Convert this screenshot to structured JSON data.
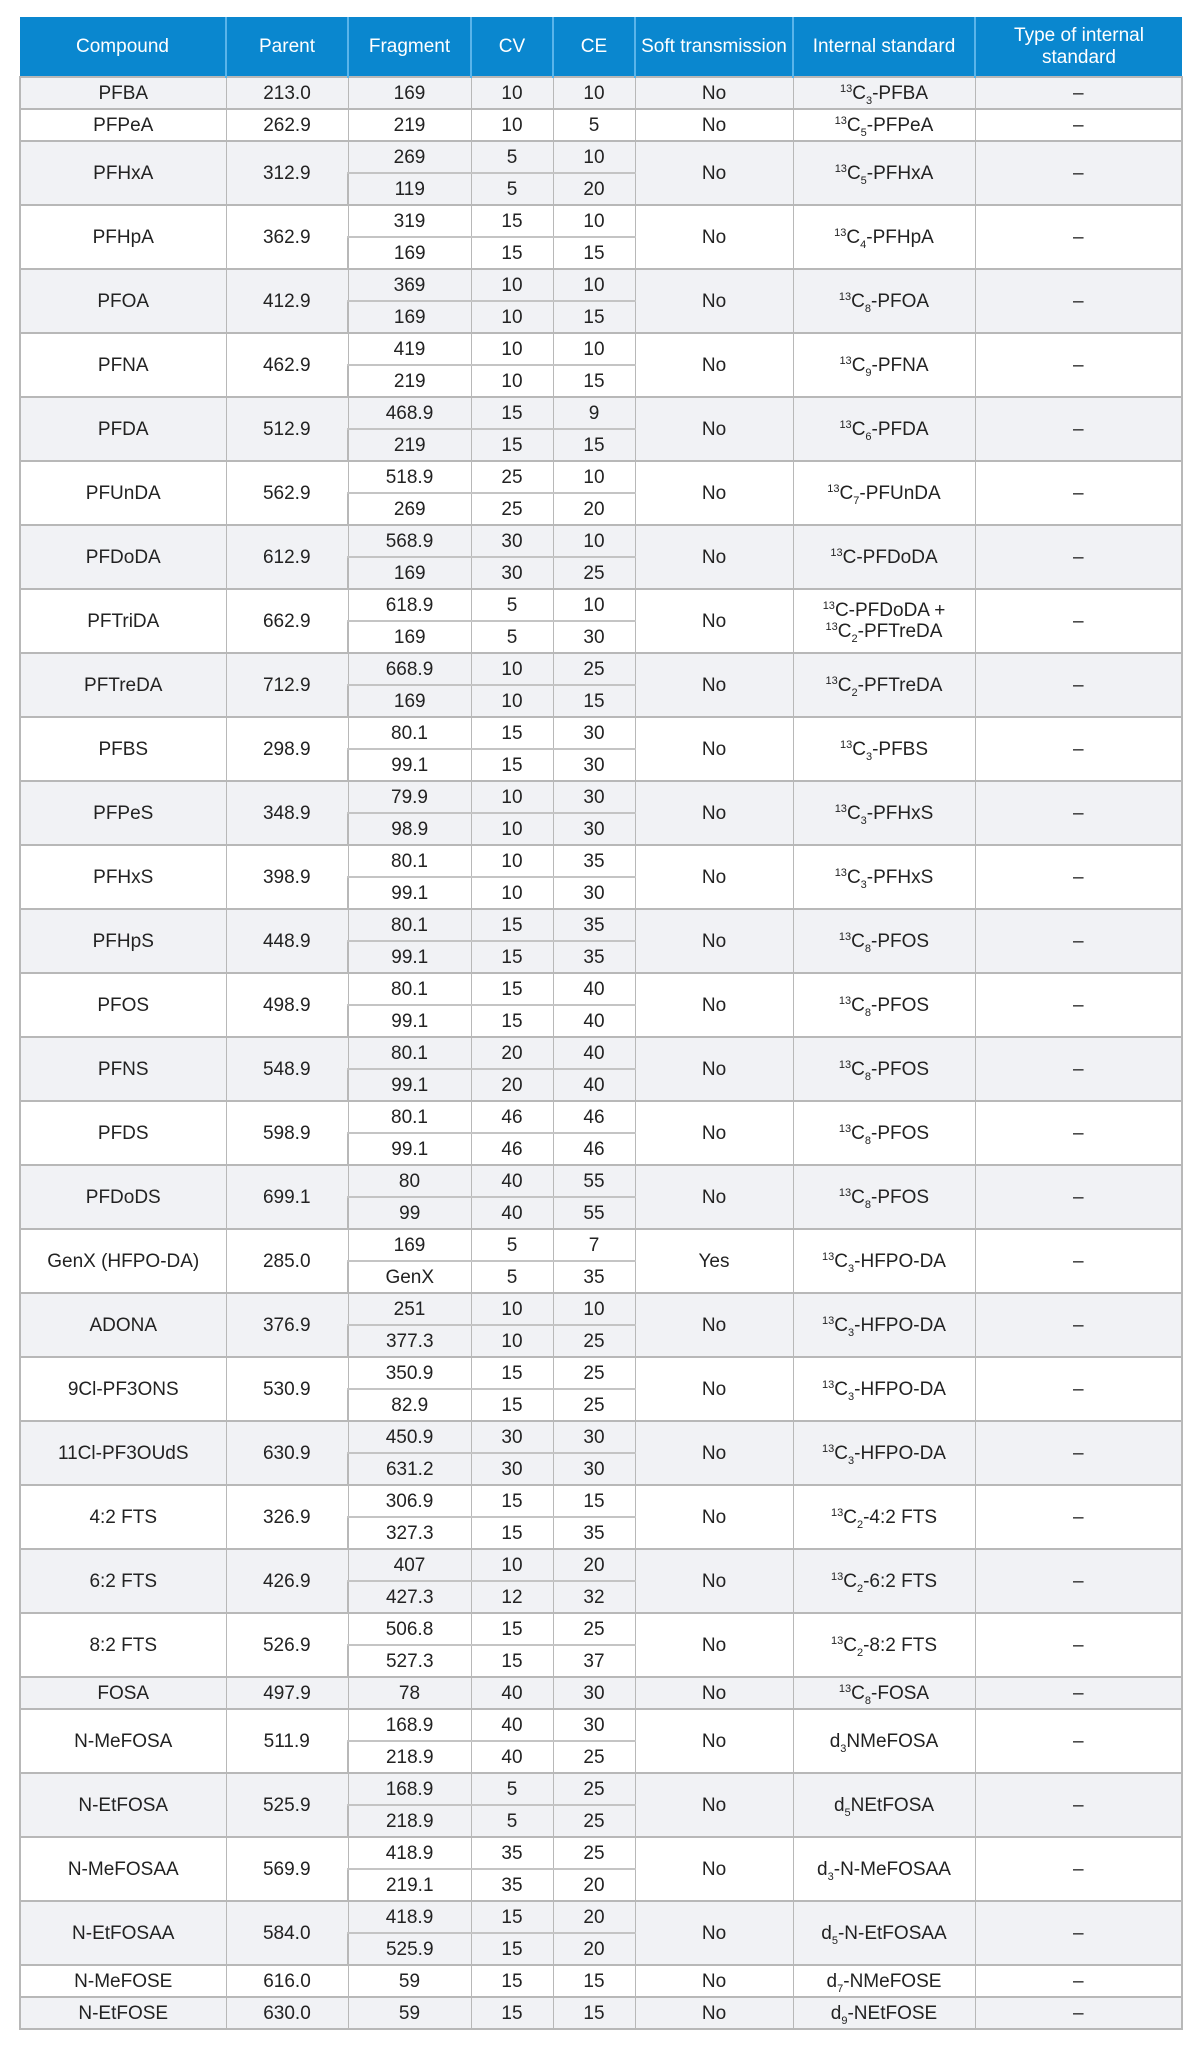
{
  "table": {
    "headers": {
      "compound": "Compound",
      "parent": "Parent",
      "fragment": "Fragment",
      "cv": "CV",
      "ce": "CE",
      "soft_transmission": "Soft transmission",
      "internal_standard": "Internal standard",
      "type_of_internal_standard": "Type of internal standard"
    },
    "colors": {
      "header_bg": "#0a87cf",
      "header_text": "#ffffff",
      "alt_row_bg": "#f1f2f5",
      "border": "#b8b8b8"
    },
    "rows": [
      {
        "compound": "PFBA",
        "parent": "213.0",
        "transitions": [
          {
            "fragment": "169",
            "cv": "10",
            "ce": "10"
          }
        ],
        "soft": "No",
        "is": [
          {
            "sup": "13",
            "base": "C",
            "sub": "3",
            "rest": "-PFBA"
          }
        ],
        "type": "–"
      },
      {
        "compound": "PFPeA",
        "parent": "262.9",
        "transitions": [
          {
            "fragment": "219",
            "cv": "10",
            "ce": "5"
          }
        ],
        "soft": "No",
        "is": [
          {
            "sup": "13",
            "base": "C",
            "sub": "5",
            "rest": "-PFPeA"
          }
        ],
        "type": "–"
      },
      {
        "compound": "PFHxA",
        "parent": "312.9",
        "transitions": [
          {
            "fragment": "269",
            "cv": "5",
            "ce": "10"
          },
          {
            "fragment": "119",
            "cv": "5",
            "ce": "20"
          }
        ],
        "soft": "No",
        "is": [
          {
            "sup": "13",
            "base": "C",
            "sub": "5",
            "rest": "-PFHxA"
          }
        ],
        "type": "–"
      },
      {
        "compound": "PFHpA",
        "parent": "362.9",
        "transitions": [
          {
            "fragment": "319",
            "cv": "15",
            "ce": "10"
          },
          {
            "fragment": "169",
            "cv": "15",
            "ce": "15"
          }
        ],
        "soft": "No",
        "is": [
          {
            "sup": "13",
            "base": "C",
            "sub": "4",
            "rest": "-PFHpA"
          }
        ],
        "type": "–"
      },
      {
        "compound": "PFOA",
        "parent": "412.9",
        "transitions": [
          {
            "fragment": "369",
            "cv": "10",
            "ce": "10"
          },
          {
            "fragment": "169",
            "cv": "10",
            "ce": "15"
          }
        ],
        "soft": "No",
        "is": [
          {
            "sup": "13",
            "base": "C",
            "sub": "8",
            "rest": "-PFOA"
          }
        ],
        "type": "–"
      },
      {
        "compound": "PFNA",
        "parent": "462.9",
        "transitions": [
          {
            "fragment": "419",
            "cv": "10",
            "ce": "10"
          },
          {
            "fragment": "219",
            "cv": "10",
            "ce": "15"
          }
        ],
        "soft": "No",
        "is": [
          {
            "sup": "13",
            "base": "C",
            "sub": "9",
            "rest": "-PFNA"
          }
        ],
        "type": "–"
      },
      {
        "compound": "PFDA",
        "parent": "512.9",
        "transitions": [
          {
            "fragment": "468.9",
            "cv": "15",
            "ce": "9"
          },
          {
            "fragment": "219",
            "cv": "15",
            "ce": "15"
          }
        ],
        "soft": "No",
        "is": [
          {
            "sup": "13",
            "base": "C",
            "sub": "6",
            "rest": "-PFDA"
          }
        ],
        "type": "–"
      },
      {
        "compound": "PFUnDA",
        "parent": "562.9",
        "transitions": [
          {
            "fragment": "518.9",
            "cv": "25",
            "ce": "10"
          },
          {
            "fragment": "269",
            "cv": "25",
            "ce": "20"
          }
        ],
        "soft": "No",
        "is": [
          {
            "sup": "13",
            "base": "C",
            "sub": "7",
            "rest": "-PFUnDA"
          }
        ],
        "type": "–"
      },
      {
        "compound": "PFDoDA",
        "parent": "612.9",
        "transitions": [
          {
            "fragment": "568.9",
            "cv": "30",
            "ce": "10"
          },
          {
            "fragment": "169",
            "cv": "30",
            "ce": "25"
          }
        ],
        "soft": "No",
        "is": [
          {
            "sup": "13",
            "base": "C",
            "sub": "",
            "rest": "-PFDoDA"
          }
        ],
        "type": "–"
      },
      {
        "compound": "PFTriDA",
        "parent": "662.9",
        "transitions": [
          {
            "fragment": "618.9",
            "cv": "5",
            "ce": "10"
          },
          {
            "fragment": "169",
            "cv": "5",
            "ce": "30"
          }
        ],
        "soft": "No",
        "is": [
          {
            "sup": "13",
            "base": "C",
            "sub": "",
            "rest": "-PFDoDA +"
          },
          {
            "sup": "13",
            "base": "C",
            "sub": "2",
            "rest": "-PFTreDA"
          }
        ],
        "type": "–"
      },
      {
        "compound": "PFTreDA",
        "parent": "712.9",
        "transitions": [
          {
            "fragment": "668.9",
            "cv": "10",
            "ce": "25"
          },
          {
            "fragment": "169",
            "cv": "10",
            "ce": "15"
          }
        ],
        "soft": "No",
        "is": [
          {
            "sup": "13",
            "base": "C",
            "sub": "2",
            "rest": "-PFTreDA"
          }
        ],
        "type": "–"
      },
      {
        "compound": "PFBS",
        "parent": "298.9",
        "transitions": [
          {
            "fragment": "80.1",
            "cv": "15",
            "ce": "30"
          },
          {
            "fragment": "99.1",
            "cv": "15",
            "ce": "30"
          }
        ],
        "soft": "No",
        "is": [
          {
            "sup": "13",
            "base": "C",
            "sub": "3",
            "rest": "-PFBS"
          }
        ],
        "type": "–"
      },
      {
        "compound": "PFPeS",
        "parent": "348.9",
        "transitions": [
          {
            "fragment": "79.9",
            "cv": "10",
            "ce": "30"
          },
          {
            "fragment": "98.9",
            "cv": "10",
            "ce": "30"
          }
        ],
        "soft": "No",
        "is": [
          {
            "sup": "13",
            "base": "C",
            "sub": "3",
            "rest": "-PFHxS"
          }
        ],
        "type": "–"
      },
      {
        "compound": "PFHxS",
        "parent": "398.9",
        "transitions": [
          {
            "fragment": "80.1",
            "cv": "10",
            "ce": "35"
          },
          {
            "fragment": "99.1",
            "cv": "10",
            "ce": "30"
          }
        ],
        "soft": "No",
        "is": [
          {
            "sup": "13",
            "base": "C",
            "sub": "3",
            "rest": "-PFHxS"
          }
        ],
        "type": "–"
      },
      {
        "compound": "PFHpS",
        "parent": "448.9",
        "transitions": [
          {
            "fragment": "80.1",
            "cv": "15",
            "ce": "35"
          },
          {
            "fragment": "99.1",
            "cv": "15",
            "ce": "35"
          }
        ],
        "soft": "No",
        "is": [
          {
            "sup": "13",
            "base": "C",
            "sub": "8",
            "rest": "-PFOS"
          }
        ],
        "type": "–"
      },
      {
        "compound": "PFOS",
        "parent": "498.9",
        "transitions": [
          {
            "fragment": "80.1",
            "cv": "15",
            "ce": "40"
          },
          {
            "fragment": "99.1",
            "cv": "15",
            "ce": "40"
          }
        ],
        "soft": "No",
        "is": [
          {
            "sup": "13",
            "base": "C",
            "sub": "8",
            "rest": "-PFOS"
          }
        ],
        "type": "–"
      },
      {
        "compound": "PFNS",
        "parent": "548.9",
        "transitions": [
          {
            "fragment": "80.1",
            "cv": "20",
            "ce": "40"
          },
          {
            "fragment": "99.1",
            "cv": "20",
            "ce": "40"
          }
        ],
        "soft": "No",
        "is": [
          {
            "sup": "13",
            "base": "C",
            "sub": "8",
            "rest": "-PFOS"
          }
        ],
        "type": "–"
      },
      {
        "compound": "PFDS",
        "parent": "598.9",
        "transitions": [
          {
            "fragment": "80.1",
            "cv": "46",
            "ce": "46"
          },
          {
            "fragment": "99.1",
            "cv": "46",
            "ce": "46"
          }
        ],
        "soft": "No",
        "is": [
          {
            "sup": "13",
            "base": "C",
            "sub": "8",
            "rest": "-PFOS"
          }
        ],
        "type": "–"
      },
      {
        "compound": "PFDoDS",
        "parent": "699.1",
        "transitions": [
          {
            "fragment": "80",
            "cv": "40",
            "ce": "55"
          },
          {
            "fragment": "99",
            "cv": "40",
            "ce": "55"
          }
        ],
        "soft": "No",
        "is": [
          {
            "sup": "13",
            "base": "C",
            "sub": "8",
            "rest": "-PFOS"
          }
        ],
        "type": "–"
      },
      {
        "compound": "GenX (HFPO-DA)",
        "parent": "285.0",
        "transitions": [
          {
            "fragment": "169",
            "cv": "5",
            "ce": "7"
          },
          {
            "fragment": "GenX",
            "cv": "5",
            "ce": "35"
          }
        ],
        "soft": "Yes",
        "is": [
          {
            "sup": "13",
            "base": "C",
            "sub": "3",
            "rest": "-HFPO-DA"
          }
        ],
        "type": "–"
      },
      {
        "compound": "ADONA",
        "parent": "376.9",
        "transitions": [
          {
            "fragment": "251",
            "cv": "10",
            "ce": "10"
          },
          {
            "fragment": "377.3",
            "cv": "10",
            "ce": "25"
          }
        ],
        "soft": "No",
        "is": [
          {
            "sup": "13",
            "base": "C",
            "sub": "3",
            "rest": "-HFPO-DA"
          }
        ],
        "type": "–"
      },
      {
        "compound": "9Cl-PF3ONS",
        "parent": "530.9",
        "transitions": [
          {
            "fragment": "350.9",
            "cv": "15",
            "ce": "25"
          },
          {
            "fragment": "82.9",
            "cv": "15",
            "ce": "25"
          }
        ],
        "soft": "No",
        "is": [
          {
            "sup": "13",
            "base": "C",
            "sub": "3",
            "rest": "-HFPO-DA"
          }
        ],
        "type": "–"
      },
      {
        "compound": "11Cl-PF3OUdS",
        "parent": "630.9",
        "transitions": [
          {
            "fragment": "450.9",
            "cv": "30",
            "ce": "30"
          },
          {
            "fragment": "631.2",
            "cv": "30",
            "ce": "30"
          }
        ],
        "soft": "No",
        "is": [
          {
            "sup": "13",
            "base": "C",
            "sub": "3",
            "rest": "-HFPO-DA"
          }
        ],
        "type": "–"
      },
      {
        "compound": "4:2 FTS",
        "parent": "326.9",
        "transitions": [
          {
            "fragment": "306.9",
            "cv": "15",
            "ce": "15"
          },
          {
            "fragment": "327.3",
            "cv": "15",
            "ce": "35"
          }
        ],
        "soft": "No",
        "is": [
          {
            "sup": "13",
            "base": "C",
            "sub": "2",
            "rest": "-4:2 FTS"
          }
        ],
        "type": "–"
      },
      {
        "compound": "6:2 FTS",
        "parent": "426.9",
        "transitions": [
          {
            "fragment": "407",
            "cv": "10",
            "ce": "20"
          },
          {
            "fragment": "427.3",
            "cv": "12",
            "ce": "32"
          }
        ],
        "soft": "No",
        "is": [
          {
            "sup": "13",
            "base": "C",
            "sub": "2",
            "rest": "-6:2 FTS"
          }
        ],
        "type": "–"
      },
      {
        "compound": "8:2 FTS",
        "parent": "526.9",
        "transitions": [
          {
            "fragment": "506.8",
            "cv": "15",
            "ce": "25"
          },
          {
            "fragment": "527.3",
            "cv": "15",
            "ce": "37"
          }
        ],
        "soft": "No",
        "is": [
          {
            "sup": "13",
            "base": "C",
            "sub": "2",
            "rest": "-8:2 FTS"
          }
        ],
        "type": "–"
      },
      {
        "compound": "FOSA",
        "parent": "497.9",
        "transitions": [
          {
            "fragment": "78",
            "cv": "40",
            "ce": "30"
          }
        ],
        "soft": "No",
        "is": [
          {
            "sup": "13",
            "base": "C",
            "sub": "8",
            "rest": "-FOSA"
          }
        ],
        "type": "–"
      },
      {
        "compound": "N-MeFOSA",
        "parent": "511.9",
        "transitions": [
          {
            "fragment": "168.9",
            "cv": "40",
            "ce": "30"
          },
          {
            "fragment": "218.9",
            "cv": "40",
            "ce": "25"
          }
        ],
        "soft": "No",
        "is": [
          {
            "sup": "",
            "base": "d",
            "sub": "3",
            "rest": "NMeFOSA"
          }
        ],
        "type": "–"
      },
      {
        "compound": "N-EtFOSA",
        "parent": "525.9",
        "transitions": [
          {
            "fragment": "168.9",
            "cv": "5",
            "ce": "25"
          },
          {
            "fragment": "218.9",
            "cv": "5",
            "ce": "25"
          }
        ],
        "soft": "No",
        "is": [
          {
            "sup": "",
            "base": "d",
            "sub": "5",
            "rest": "NEtFOSA"
          }
        ],
        "type": "–"
      },
      {
        "compound": "N-MeFOSAA",
        "parent": "569.9",
        "transitions": [
          {
            "fragment": "418.9",
            "cv": "35",
            "ce": "25"
          },
          {
            "fragment": "219.1",
            "cv": "35",
            "ce": "20"
          }
        ],
        "soft": "No",
        "is": [
          {
            "sup": "",
            "base": "d",
            "sub": "3",
            "rest": "-N-MeFOSAA"
          }
        ],
        "type": "–"
      },
      {
        "compound": "N-EtFOSAA",
        "parent": "584.0",
        "transitions": [
          {
            "fragment": "418.9",
            "cv": "15",
            "ce": "20"
          },
          {
            "fragment": "525.9",
            "cv": "15",
            "ce": "20"
          }
        ],
        "soft": "No",
        "is": [
          {
            "sup": "",
            "base": "d",
            "sub": "5",
            "rest": "-N-EtFOSAA"
          }
        ],
        "type": "–"
      },
      {
        "compound": "N-MeFOSE",
        "parent": "616.0",
        "transitions": [
          {
            "fragment": "59",
            "cv": "15",
            "ce": "15"
          }
        ],
        "soft": "No",
        "is": [
          {
            "sup": "",
            "base": "d",
            "sub": "7",
            "rest": "-NMeFOSE"
          }
        ],
        "type": "–"
      },
      {
        "compound": "N-EtFOSE",
        "parent": "630.0",
        "transitions": [
          {
            "fragment": "59",
            "cv": "15",
            "ce": "15"
          }
        ],
        "soft": "No",
        "is": [
          {
            "sup": "",
            "base": "d",
            "sub": "9",
            "rest": "-NEtFOSE"
          }
        ],
        "type": "–"
      }
    ]
  }
}
